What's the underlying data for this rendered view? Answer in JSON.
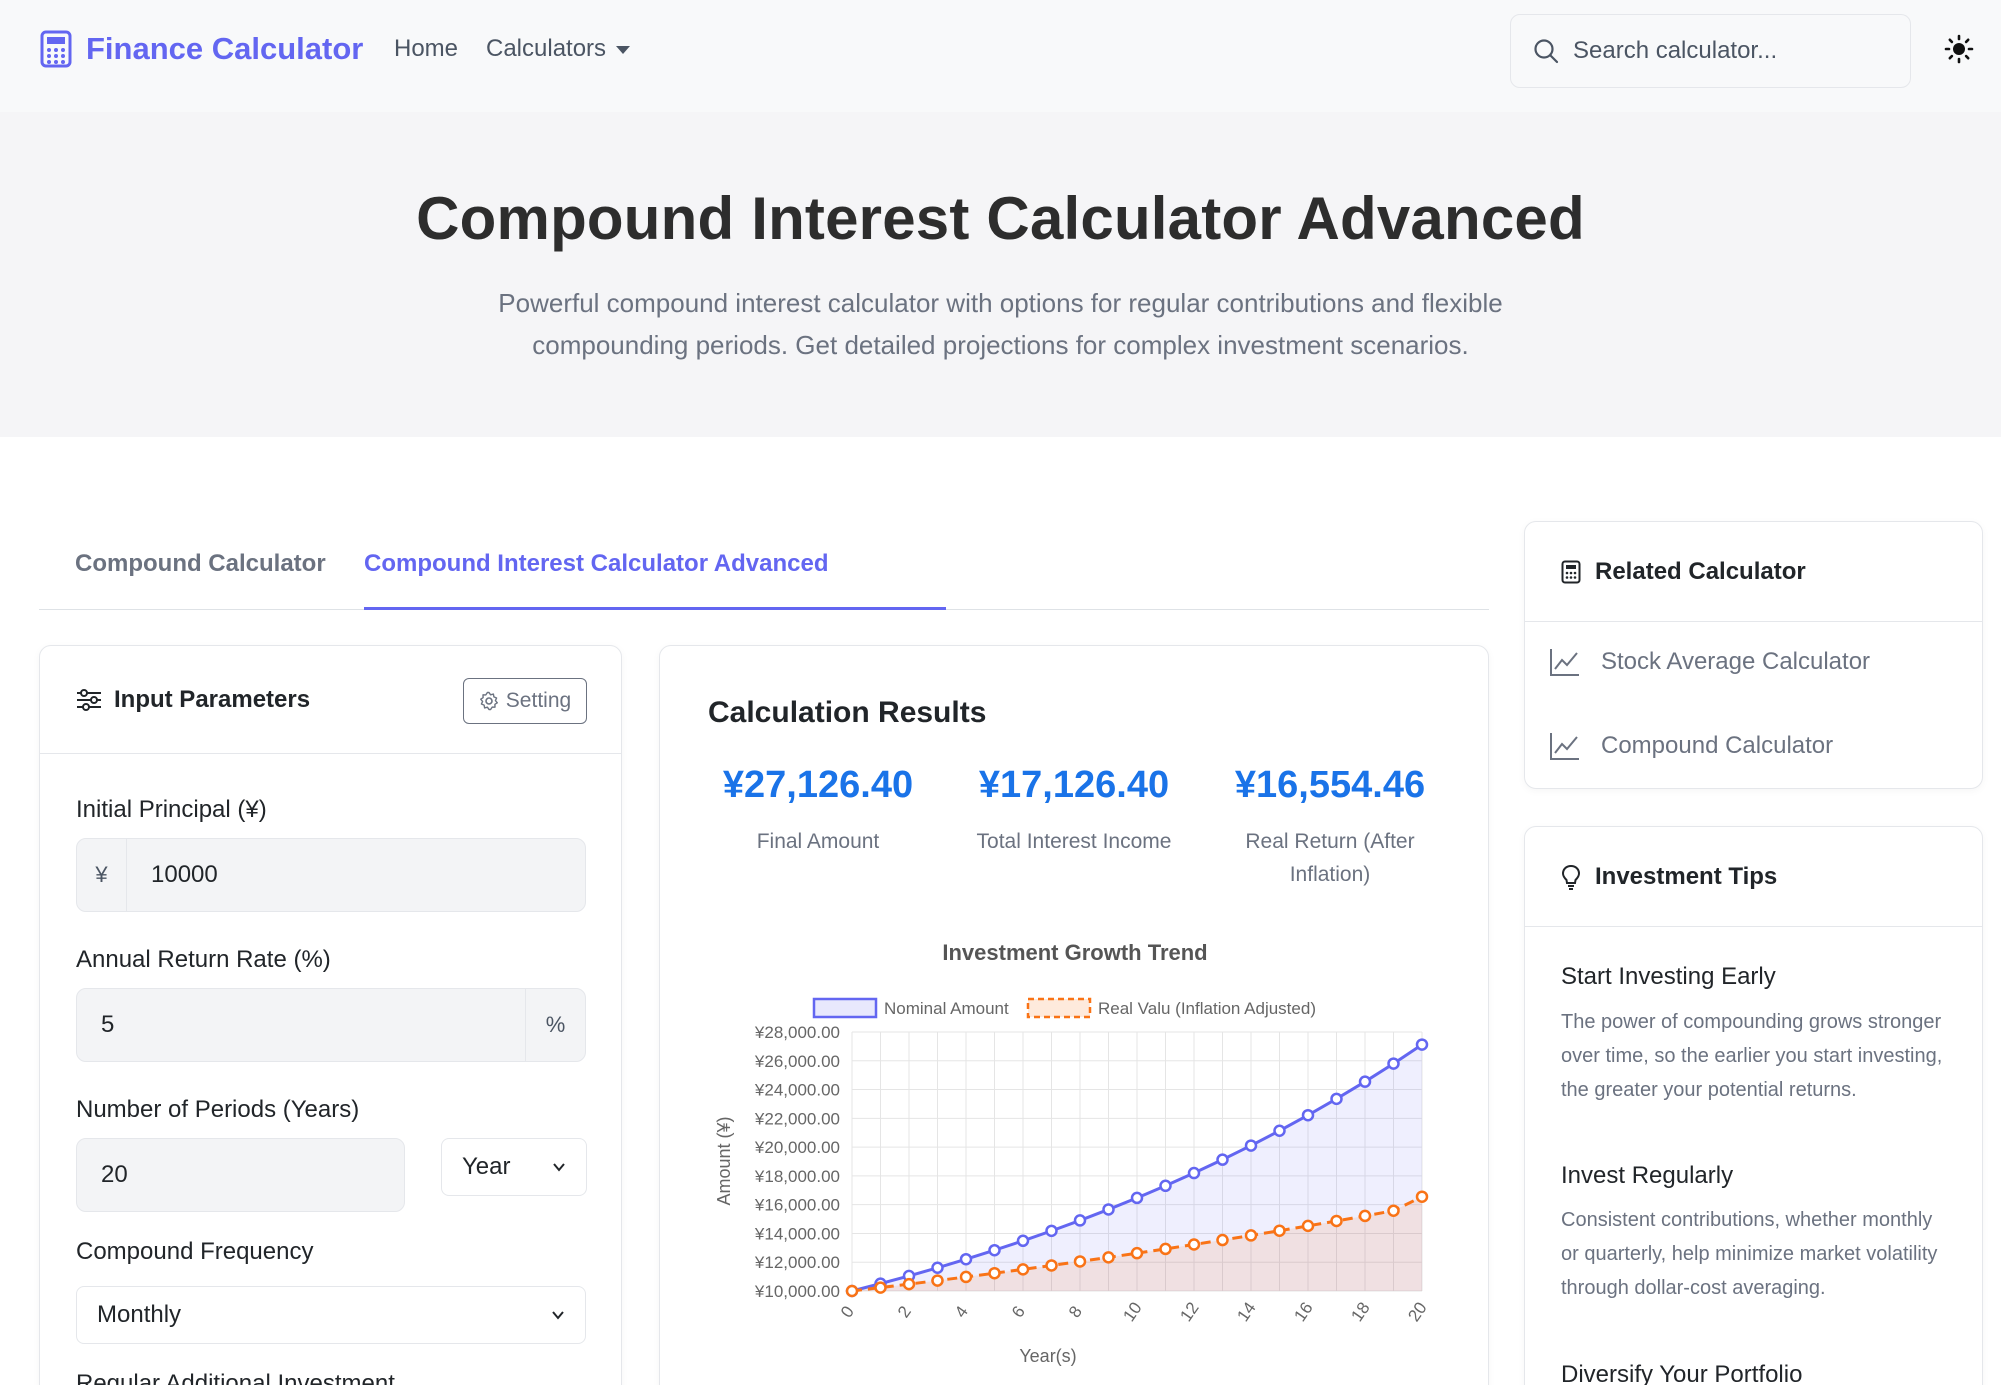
{
  "nav": {
    "brand": "Finance Calculator",
    "home": "Home",
    "calculators": "Calculators",
    "search_placeholder": "Search calculator..."
  },
  "hero": {
    "title": "Compound Interest Calculator Advanced",
    "description": "Powerful compound interest calculator with options for regular contributions and flexible compounding periods. Get detailed projections for complex investment scenarios."
  },
  "tabs": [
    {
      "label": "Compound Calculator",
      "active": false
    },
    {
      "label": "Compound Interest Calculator Advanced",
      "active": true
    }
  ],
  "inputs": {
    "title": "Input Parameters",
    "setting_label": "Setting",
    "principal_label": "Initial Principal (¥)",
    "principal_prefix": "¥",
    "principal_value": "10000",
    "rate_label": "Annual Return Rate (%)",
    "rate_value": "5",
    "rate_suffix": "%",
    "periods_label": "Number of Periods (Years)",
    "periods_value": "20",
    "period_unit": "Year",
    "frequency_label": "Compound Frequency",
    "frequency_value": "Monthly",
    "additional_label": "Regular Additional Investment"
  },
  "results": {
    "title": "Calculation Results",
    "stats": [
      {
        "value": "¥27,126.40",
        "label": "Final Amount"
      },
      {
        "value": "¥17,126.40",
        "label": "Total Interest Income"
      },
      {
        "value": "¥16,554.46",
        "label": "Real Return (After Inflation)"
      }
    ]
  },
  "chart_data": {
    "type": "line",
    "title": "Investment Growth Trend",
    "xlabel": "Year(s)",
    "ylabel": "Amount (¥)",
    "x": [
      0,
      1,
      2,
      3,
      4,
      5,
      6,
      7,
      8,
      9,
      10,
      11,
      12,
      13,
      14,
      15,
      16,
      17,
      18,
      19,
      20
    ],
    "xticks": [
      "0",
      "2",
      "4",
      "6",
      "8",
      "10",
      "12",
      "14",
      "16",
      "18",
      "20"
    ],
    "ylim": [
      10000,
      28000
    ],
    "yticks": [
      "¥10,000.00",
      "¥12,000.00",
      "¥14,000.00",
      "¥16,000.00",
      "¥18,000.00",
      "¥20,000.00",
      "¥22,000.00",
      "¥24,000.00",
      "¥26,000.00",
      "¥28,000.00"
    ],
    "legend_position": "top",
    "series": [
      {
        "name": "Nominal Amount",
        "color": "#6366f1",
        "style": "solid",
        "values": [
          10000,
          10512,
          11049,
          11615,
          12209,
          12834,
          13490,
          14180,
          14905,
          15668,
          16470,
          17312,
          18198,
          19129,
          20107,
          21136,
          22217,
          23354,
          24548,
          25804,
          27126
        ]
      },
      {
        "name": "Real Valu (Inflation Adjusted)",
        "color": "#f97316",
        "style": "dashed",
        "values": [
          10000,
          10236,
          10478,
          10725,
          10978,
          11237,
          11503,
          11774,
          12052,
          12337,
          12628,
          12926,
          13231,
          13543,
          13863,
          14190,
          14525,
          14868,
          15219,
          15578,
          16554
        ]
      }
    ]
  },
  "related": {
    "title": "Related Calculator",
    "links": [
      "Stock Average Calculator",
      "Compound Calculator"
    ]
  },
  "tips": {
    "title": "Investment Tips",
    "items": [
      {
        "title": "Start Investing Early",
        "text": "The power of compounding grows stronger over time, so the earlier you start investing, the greater your potential returns."
      },
      {
        "title": "Invest Regularly",
        "text": "Consistent contributions, whether monthly or quarterly, help minimize market volatility through dollar-cost averaging."
      },
      {
        "title": "Diversify Your Portfolio",
        "text": ""
      }
    ]
  }
}
